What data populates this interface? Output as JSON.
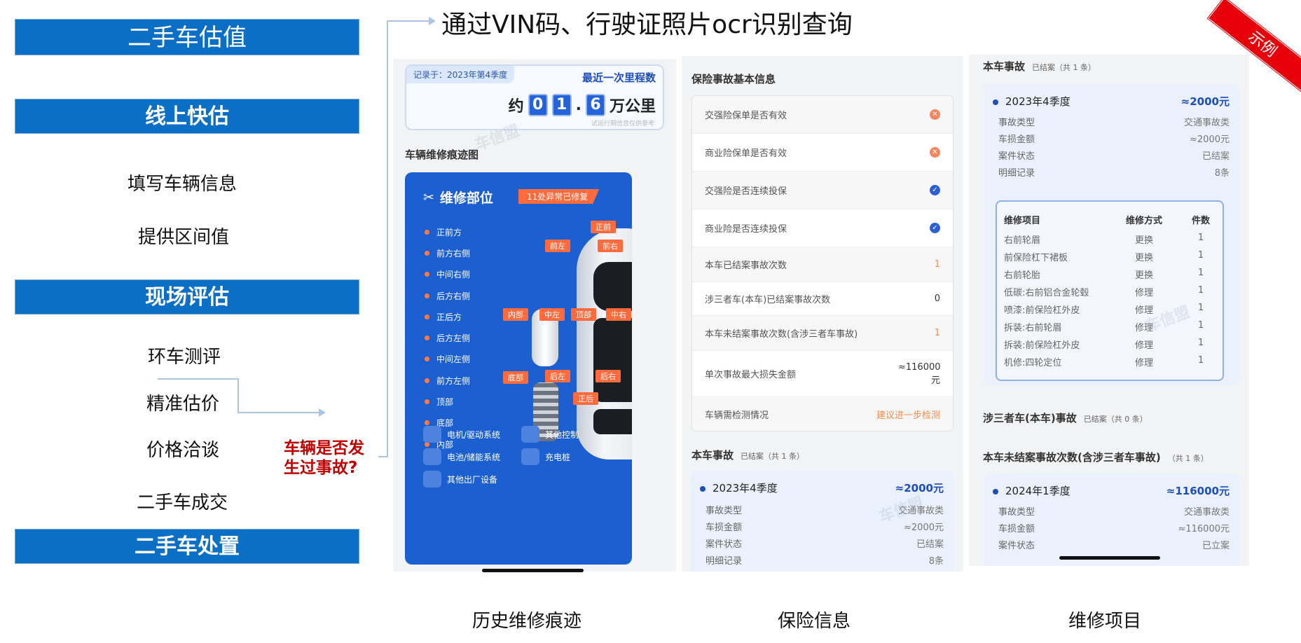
{
  "left": {
    "title": "二手车估值",
    "online_title": "线上快估",
    "online_steps": [
      "填写车辆信息",
      "提供区间值"
    ],
    "onsite_title": "现场评估",
    "onsite_steps": [
      "环车测评",
      "精准估价",
      "价格洽谈",
      "二手车成交"
    ],
    "dispose_title": "二手车处置",
    "question": "车辆是否发生过事故?"
  },
  "headline": "通过VIN码、行驶证照片ocr识别查询",
  "badge": "示例",
  "captions": [
    "历史维修痕迹",
    "保险信息",
    "维修项目"
  ],
  "colors": {
    "accent_blue": "#0b6fc6",
    "orange": "#ff6b3d",
    "badge_red": "#e8000b"
  },
  "watermark": "车信盟",
  "repair": {
    "record_tag": "记录于：2023年第4季度",
    "mileage_label": "最近一次里程数",
    "mileage_prefix": "约",
    "mileage_digits": [
      "0",
      "1",
      "6"
    ],
    "mileage_dot": ".",
    "mileage_unit": "万公里",
    "mileage_note": "试运行期信息仅供参考",
    "map_title": "车辆维修痕迹图",
    "parts_title": "维修部位",
    "parts_badge": "11处异常已修复",
    "parts": [
      "正前方",
      "前方右侧",
      "中间右侧",
      "后方右侧",
      "正后方",
      "后方左侧",
      "中间左侧",
      "前方左侧",
      "顶部",
      "底部",
      "内部"
    ],
    "car_tags": [
      "正前",
      "前左",
      "前右",
      "内部",
      "中左",
      "顶部",
      "中右",
      "底部",
      "后左",
      "后右",
      "正后"
    ],
    "systems": [
      "电机/驱动系统",
      "其他控制",
      "电池/储能系统",
      "充电桩",
      "其他出厂设备"
    ]
  },
  "insurance": {
    "title": "保险事故基本信息",
    "rows": [
      {
        "label": "交强险保单是否有效",
        "value": "✕"
      },
      {
        "label": "商业险保单是否有效",
        "value": "✕"
      },
      {
        "label": "交强险是否连续投保",
        "value": "✓"
      },
      {
        "label": "商业险是否连续投保",
        "value": "✓"
      },
      {
        "label": "本车已结案事故次数",
        "value": "1"
      },
      {
        "label": "涉三者车(本车)已结案事故次数",
        "value": "0"
      },
      {
        "label": "本车未结案事故次数(含涉三者车事故)",
        "value": "1"
      },
      {
        "label": "单次事故最大损失金额",
        "value": "≈116000元"
      },
      {
        "label": "车辆需检测情况",
        "value": "建议进一步检测"
      }
    ],
    "accident_title": "本车事故",
    "accident_sub": "已结案（共 1 条）",
    "accident": {
      "period": "2023年4季度",
      "amount": "≈2000元",
      "fields": [
        {
          "label": "事故类型",
          "value": "交通事故类"
        },
        {
          "label": "车损金额",
          "value": "≈2000元"
        },
        {
          "label": "案件状态",
          "value": "已结案"
        },
        {
          "label": "明细记录",
          "value": "8条"
        }
      ]
    }
  },
  "items": {
    "accident_title": "本车事故",
    "accident_sub": "已结案（共 1 条）",
    "accident": {
      "period": "2023年4季度",
      "amount": "≈2000元",
      "fields": [
        {
          "label": "事故类型",
          "value": "交通事故类"
        },
        {
          "label": "车损金额",
          "value": "≈2000元"
        },
        {
          "label": "案件状态",
          "value": "已结案"
        },
        {
          "label": "明细记录",
          "value": "8条"
        }
      ]
    },
    "table_headers": [
      "维修项目",
      "维修方式",
      "件数"
    ],
    "table_rows": [
      [
        "右前轮眉",
        "更换",
        "1"
      ],
      [
        "前保险杠下裙板",
        "更换",
        "1"
      ],
      [
        "右前轮胎",
        "更换",
        "1"
      ],
      [
        "低碳:右前铝合金轮毂",
        "修理",
        "1"
      ],
      [
        "喷漆:前保险杠外皮",
        "修理",
        "1"
      ],
      [
        "拆装:右前轮眉",
        "修理",
        "1"
      ],
      [
        "拆装:前保险杠外皮",
        "修理",
        "1"
      ],
      [
        "机修:四轮定位",
        "修理",
        "1"
      ]
    ],
    "third_title": "涉三者车(本车)事故",
    "third_sub": "已结案（共 0 条）",
    "open_title": "本车未结案事故次数(含涉三者车事故)",
    "open_sub": "（共 1 条）",
    "open_accident": {
      "period": "2024年1季度",
      "amount": "≈116000元",
      "fields": [
        {
          "label": "事故类型",
          "value": "交通事故类"
        },
        {
          "label": "车损金额",
          "value": "≈116000元"
        },
        {
          "label": "案件状态",
          "value": "已立案"
        }
      ]
    }
  }
}
